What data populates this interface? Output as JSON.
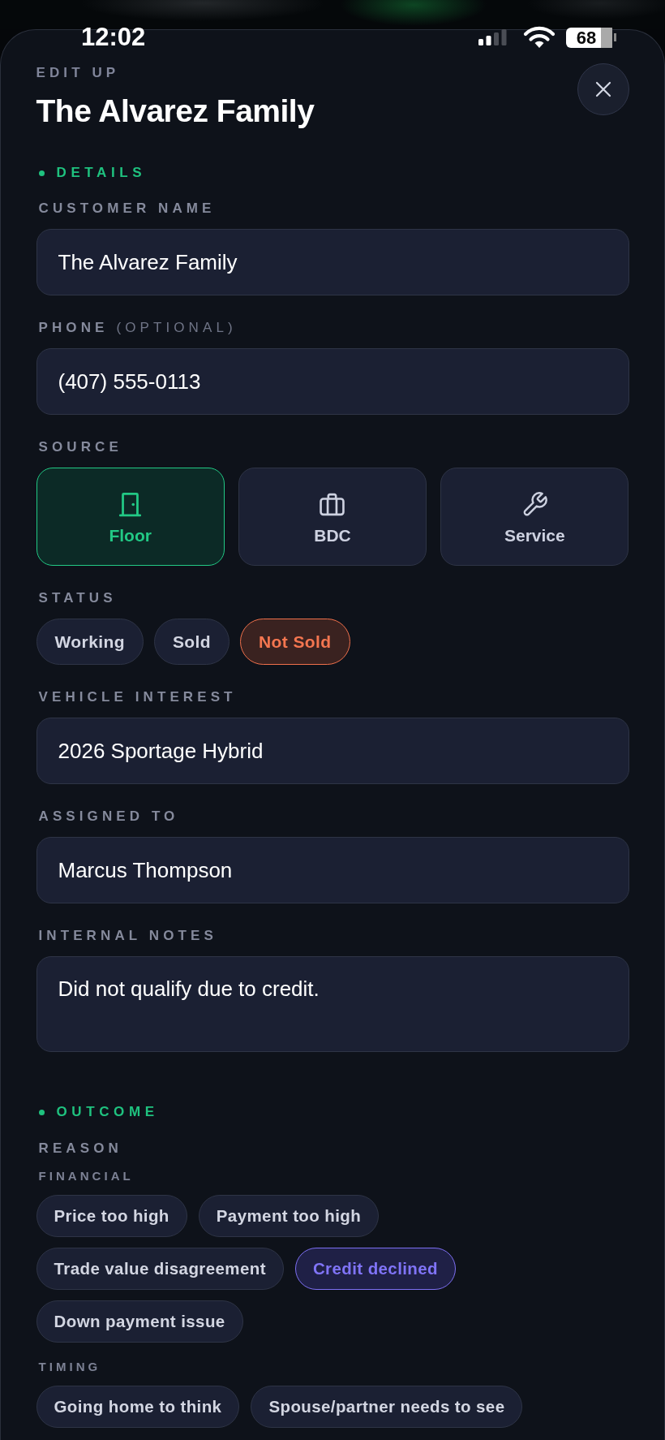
{
  "status_bar": {
    "time": "12:02",
    "battery": "68"
  },
  "header": {
    "eyebrow": "EDIT UP",
    "title": "The Alvarez Family"
  },
  "details": {
    "heading": "DETAILS",
    "fields": [
      {
        "kind": "input",
        "label": "CUSTOMER NAME",
        "value": "The Alvarez Family"
      },
      {
        "kind": "input",
        "label": "PHONE",
        "hint": "(OPTIONAL)",
        "value": "(407) 555-0113"
      },
      {
        "kind": "source",
        "label": "SOURCE",
        "options": [
          {
            "label": "Floor",
            "selected": true
          },
          {
            "label": "BDC",
            "selected": false
          },
          {
            "label": "Service",
            "selected": false
          }
        ]
      },
      {
        "kind": "status",
        "label": "STATUS",
        "options": [
          {
            "label": "Working",
            "selected": false
          },
          {
            "label": "Sold",
            "selected": false
          },
          {
            "label": "Not Sold",
            "selected": true
          }
        ]
      },
      {
        "kind": "input",
        "label": "VEHICLE INTEREST",
        "value": "2026 Sportage Hybrid"
      },
      {
        "kind": "input",
        "label": "ASSIGNED TO",
        "value": "Marcus Thompson"
      },
      {
        "kind": "notes",
        "label": "INTERNAL NOTES",
        "value": "Did not qualify due to credit."
      }
    ]
  },
  "outcome": {
    "heading": "OUTCOME",
    "label": "REASON",
    "groups": [
      {
        "label": "FINANCIAL",
        "reasons": [
          {
            "label": "Price too high",
            "selected": false
          },
          {
            "label": "Payment too high",
            "selected": false
          },
          {
            "label": "Trade value disagreement",
            "selected": false
          },
          {
            "label": "Credit declined",
            "selected": true
          },
          {
            "label": "Down payment issue",
            "selected": false
          }
        ]
      },
      {
        "label": "TIMING",
        "reasons": [
          {
            "label": "Going home to think",
            "selected": false
          },
          {
            "label": "Spouse/partner needs to see",
            "selected": false
          }
        ]
      }
    ]
  }
}
